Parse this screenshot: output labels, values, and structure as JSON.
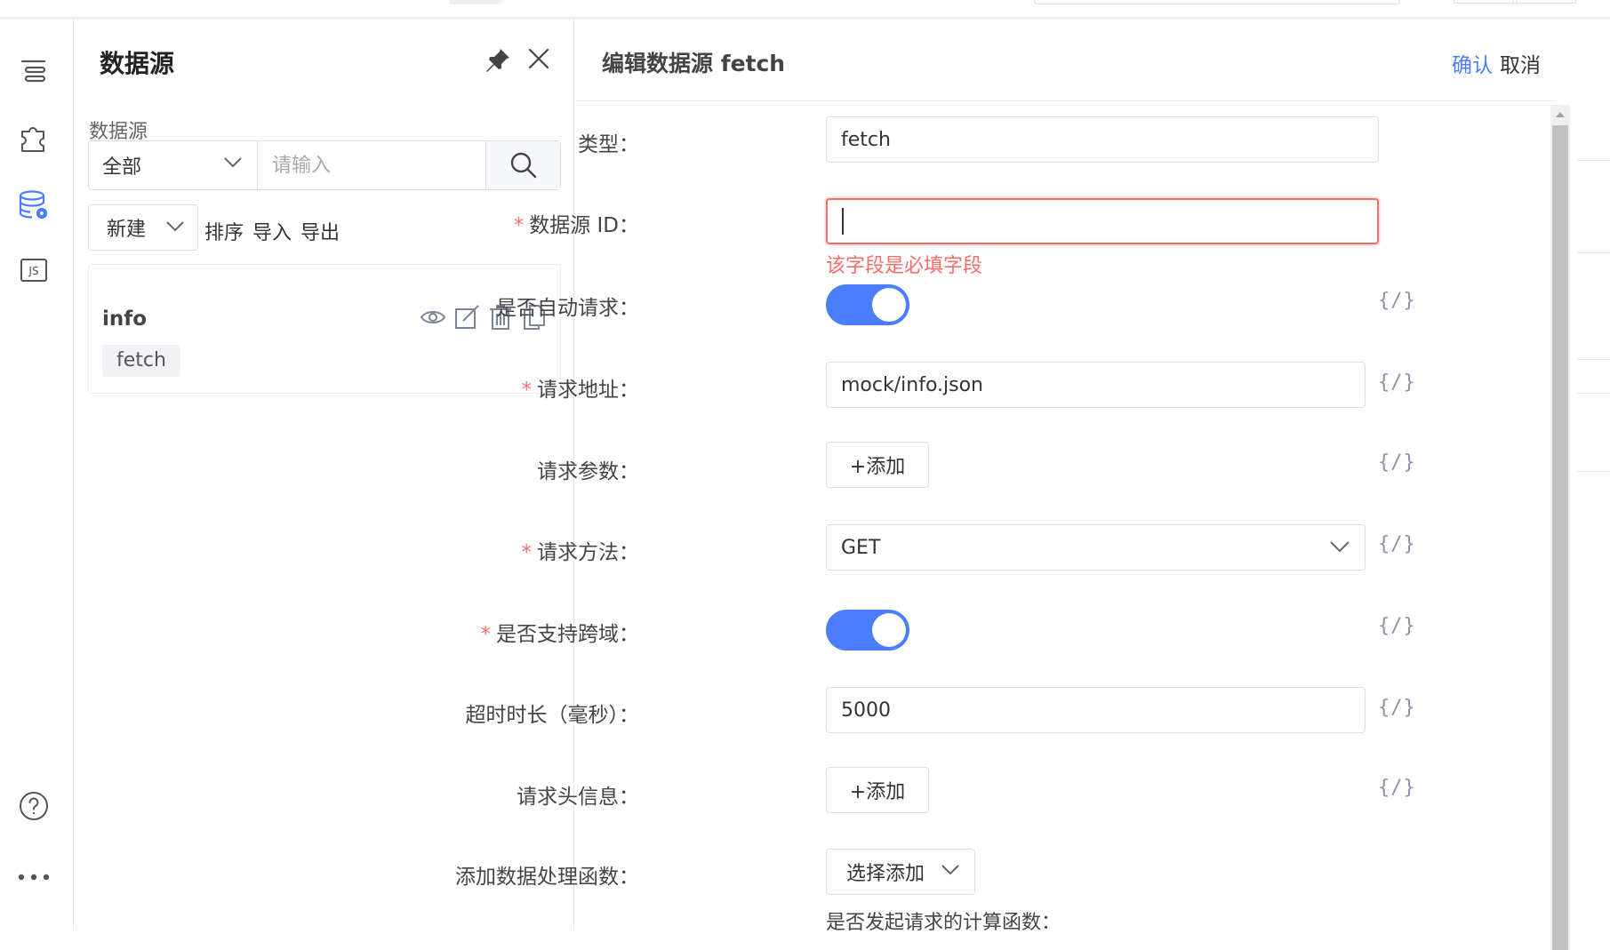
{
  "rail": {
    "items": [
      "outline-icon",
      "component-icon",
      "datasource-icon",
      "js-icon"
    ],
    "bottom": [
      "help-icon",
      "more-icon"
    ]
  },
  "panel": {
    "title": "数据源",
    "filter_label": "数据源",
    "filter_select": "全部",
    "filter_placeholder": "请输入",
    "new_label": "新建",
    "actions": [
      "排序",
      "导入",
      "导出"
    ],
    "items": [
      {
        "name": "info",
        "type": "fetch"
      }
    ]
  },
  "editor": {
    "title": "编辑数据源 fetch",
    "confirm": "确认",
    "cancel": "取消",
    "fields": {
      "type_label": "类型",
      "type_value": "fetch",
      "id_label": "数据源 ID",
      "id_value": "",
      "id_error": "该字段是必填字段",
      "auto_label": "是否自动请求",
      "url_label": "请求地址",
      "url_value": "mock/info.json",
      "params_label": "请求参数",
      "add_label": "+添加",
      "method_label": "请求方法",
      "method_value": "GET",
      "cors_label": "是否支持跨域",
      "timeout_label": "超时时长（毫秒）",
      "timeout_value": "5000",
      "headers_label": "请求头信息",
      "handler_label": "添加数据处理函数",
      "handler_select": "选择添加",
      "should_fetch_label": "是否发起请求的计算函数",
      "colon": "："
    },
    "code_btn": "{/}",
    "toggles": {
      "auto_fetch": true,
      "cors": true
    }
  },
  "colors": {
    "accent": "#4a7dff",
    "error": "#f56c6c"
  }
}
